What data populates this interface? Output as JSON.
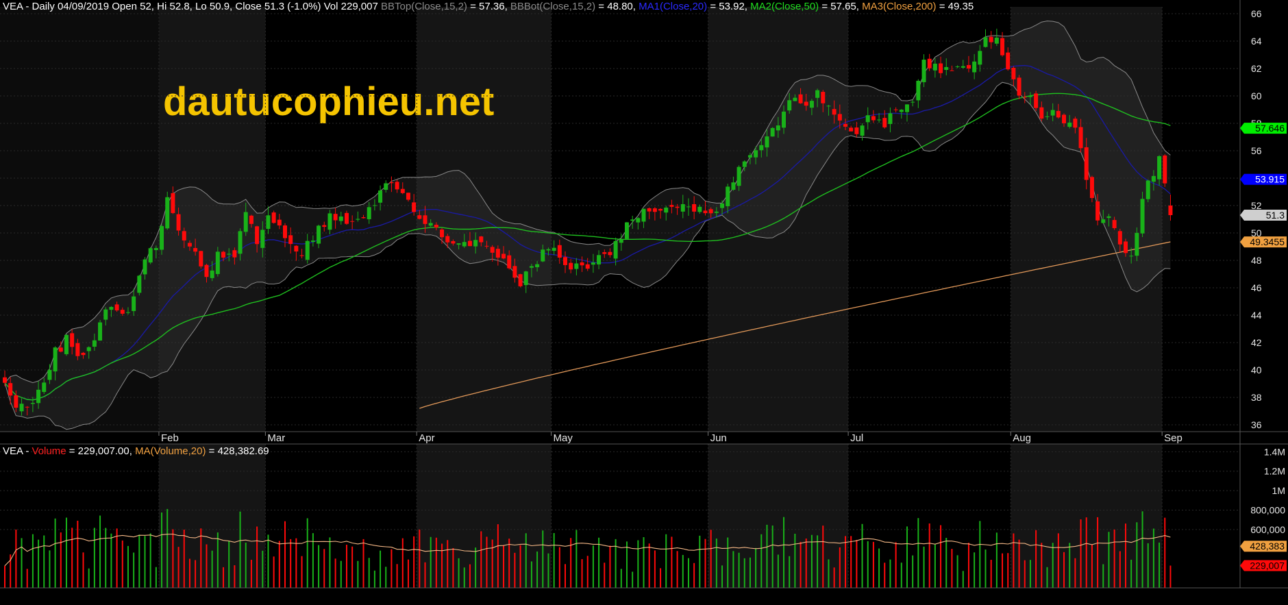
{
  "watermark": "dautucophieu.net",
  "colors": {
    "up": "#19b219",
    "down": "#ff0a0a",
    "bb": "#8a8a8a",
    "ma20": "#1a1aa0",
    "ma50": "#1fbf1f",
    "ma200": "#e49a5a",
    "volma": "#f5b886",
    "watermark": "#f5c400",
    "ma20_tag": "#0000ff",
    "ma50_tag": "#00ee00",
    "ma200_tag": "#f0a040",
    "last_tag": "#cfcfcf"
  },
  "price_header": {
    "segments": [
      {
        "text": "VEA - Daily 04/09/2019 Open 52, Hi 52.8, Lo 50.9, Close 51.3 (-1.0%) Vol 229,007 ",
        "color": "#ffffff"
      },
      {
        "text": "BBTop(Close,15,2)",
        "color": "#8a8a8a"
      },
      {
        "text": " = 57.36, ",
        "color": "#ffffff"
      },
      {
        "text": "BBBot(Close,15,2)",
        "color": "#8a8a8a"
      },
      {
        "text": " = 48.80, ",
        "color": "#ffffff"
      },
      {
        "text": "MA1(Close,20)",
        "color": "#2a2aff"
      },
      {
        "text": " = 53.92, ",
        "color": "#ffffff"
      },
      {
        "text": "MA2(Close,50)",
        "color": "#1fdd1f"
      },
      {
        "text": " = 57.65, ",
        "color": "#ffffff"
      },
      {
        "text": "MA3(Close,200)",
        "color": "#f0a040"
      },
      {
        "text": " = 49.35",
        "color": "#ffffff"
      }
    ]
  },
  "volume_header": {
    "segments": [
      {
        "text": "VEA - ",
        "color": "#ffffff"
      },
      {
        "text": "Volume",
        "color": "#ff2020"
      },
      {
        "text": " = 229,007.00, ",
        "color": "#ffffff"
      },
      {
        "text": "MA(Volume,20)",
        "color": "#f0a040"
      },
      {
        "text": " = 428,382.69",
        "color": "#ffffff"
      }
    ]
  },
  "price_axis": {
    "ylim": [
      35.5,
      66.5
    ],
    "ticks": [
      36,
      38,
      40,
      42,
      44,
      46,
      48,
      50,
      52,
      54,
      56,
      58,
      60,
      62,
      64,
      66
    ]
  },
  "volume_axis": {
    "ylim": [
      0,
      1480000
    ],
    "ticks": [
      {
        "value": 1400000,
        "label": "1.4M"
      },
      {
        "value": 1200000,
        "label": "1.2M"
      },
      {
        "value": 1000000,
        "label": "1M"
      },
      {
        "value": 800000,
        "label": "800,000"
      },
      {
        "value": 600000,
        "label": "600,000"
      }
    ]
  },
  "month_labels": [
    {
      "label": "Feb",
      "bar": 28
    },
    {
      "label": "Mar",
      "bar": 47
    },
    {
      "label": "Apr",
      "bar": 74
    },
    {
      "label": "May",
      "bar": 98
    },
    {
      "label": "Jun",
      "bar": 126
    },
    {
      "label": "Jul",
      "bar": 151
    },
    {
      "label": "Aug",
      "bar": 180
    },
    {
      "label": "Sep",
      "bar": 207
    }
  ],
  "price_tags": [
    {
      "name": "ma50-tag",
      "value": 57.646,
      "label": "57.646",
      "style": "ma50"
    },
    {
      "name": "ma20-tag",
      "value": 53.915,
      "label": "53.915",
      "style": "ma20"
    },
    {
      "name": "last-price-tag",
      "value": 51.3,
      "label": "51.3",
      "style": "last"
    },
    {
      "name": "ma200-tag",
      "value": 49.3455,
      "label": "49.3455",
      "style": "ma200"
    }
  ],
  "volume_tags": [
    {
      "name": "volume-ma-tag",
      "value": 428383,
      "label": "428,383",
      "style": "volma"
    },
    {
      "name": "volume-last-tag",
      "value": 229007,
      "label": "229,007",
      "style": "vollast"
    }
  ],
  "chart_data": {
    "type": "candlestick",
    "symbol": "VEA",
    "bar_count": 209,
    "anchors": [
      [
        0,
        39.2
      ],
      [
        2,
        37.2
      ],
      [
        5,
        37.6
      ],
      [
        7,
        39.3
      ],
      [
        9,
        41.3
      ],
      [
        11,
        42.2
      ],
      [
        13,
        41.2
      ],
      [
        16,
        42.2
      ],
      [
        18,
        44.6
      ],
      [
        22,
        44.3
      ],
      [
        25,
        48.2
      ],
      [
        27,
        49.1
      ],
      [
        29,
        52.7
      ],
      [
        31,
        50.3
      ],
      [
        34,
        48.3
      ],
      [
        36,
        46.6
      ],
      [
        38,
        48.4
      ],
      [
        41,
        48.4
      ],
      [
        43,
        51.3
      ],
      [
        45,
        49.6
      ],
      [
        47,
        51.6
      ],
      [
        49,
        50.4
      ],
      [
        51,
        49.3
      ],
      [
        53,
        48.4
      ],
      [
        56,
        50.4
      ],
      [
        58,
        51.1
      ],
      [
        61,
        50.7
      ],
      [
        64,
        50.9
      ],
      [
        67,
        52.9
      ],
      [
        69,
        53.6
      ],
      [
        72,
        52.3
      ],
      [
        74,
        51.3
      ],
      [
        77,
        50.2
      ],
      [
        79,
        49.6
      ],
      [
        82,
        49.3
      ],
      [
        85,
        49.6
      ],
      [
        88,
        48.6
      ],
      [
        90,
        47.2
      ],
      [
        92,
        46.3
      ],
      [
        94,
        47.3
      ],
      [
        96,
        48.4
      ],
      [
        98,
        48.7
      ],
      [
        100,
        47.4
      ],
      [
        103,
        47.6
      ],
      [
        106,
        48.2
      ],
      [
        108,
        48.8
      ],
      [
        110,
        49.8
      ],
      [
        112,
        51.4
      ],
      [
        115,
        51.6
      ],
      [
        118,
        52.1
      ],
      [
        121,
        52.3
      ],
      [
        124,
        51.7
      ],
      [
        126,
        51.2
      ],
      [
        128,
        52.3
      ],
      [
        130,
        53.8
      ],
      [
        132,
        55.6
      ],
      [
        134,
        56.3
      ],
      [
        137,
        57.5
      ],
      [
        140,
        59.4
      ],
      [
        143,
        59.5
      ],
      [
        145,
        60.4
      ],
      [
        148,
        58.8
      ],
      [
        150,
        57.7
      ],
      [
        152,
        57.3
      ],
      [
        154,
        58.3
      ],
      [
        156,
        57.9
      ],
      [
        158,
        58.4
      ],
      [
        160,
        59.4
      ],
      [
        162,
        59.7
      ],
      [
        164,
        62.4
      ],
      [
        166,
        62.3
      ],
      [
        168,
        61.8
      ],
      [
        171,
        62.1
      ],
      [
        173,
        62.7
      ],
      [
        175,
        64.6
      ],
      [
        177,
        64.1
      ],
      [
        179,
        62.1
      ],
      [
        181,
        60.3
      ],
      [
        183,
        60.1
      ],
      [
        185,
        58.3
      ],
      [
        187,
        59.3
      ],
      [
        189,
        58.4
      ],
      [
        191,
        57.3
      ],
      [
        193,
        54.3
      ],
      [
        195,
        50.9
      ],
      [
        197,
        51.2
      ],
      [
        199,
        49.6
      ],
      [
        201,
        48.1
      ],
      [
        203,
        52.3
      ],
      [
        205,
        54.6
      ],
      [
        206,
        55.3
      ],
      [
        208,
        51.3
      ]
    ],
    "last_bar": {
      "date": "04/09/2019",
      "open": 52,
      "high": 52.8,
      "low": 50.9,
      "close": 51.3,
      "volume": 229007
    },
    "indicators": {
      "bb_top": {
        "label": "BBTop(Close,15,2)",
        "last": 57.36
      },
      "bb_bot": {
        "label": "BBBot(Close,15,2)",
        "last": 48.8
      },
      "ma1": {
        "label": "MA1(Close,20)",
        "last": 53.92
      },
      "ma2": {
        "label": "MA2(Close,50)",
        "last": 57.65
      },
      "ma3": {
        "label": "MA3(Close,200)",
        "last": 49.35
      }
    },
    "volume": {
      "last": 229007,
      "ma20_last": 428382.69
    }
  }
}
